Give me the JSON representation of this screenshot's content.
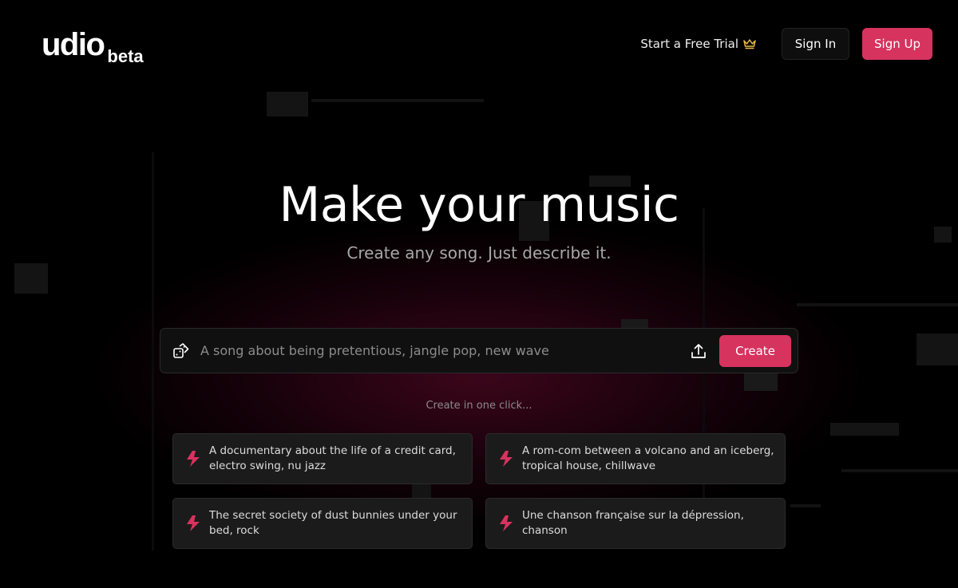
{
  "brand": {
    "name": "udio",
    "badge": "beta",
    "accent_color": "#d6335f",
    "crown_color": "#e8b84a"
  },
  "nav": {
    "trial_label": "Start a Free Trial",
    "trial_icon": "crown-icon",
    "signin_label": "Sign In",
    "signup_label": "Sign Up"
  },
  "hero": {
    "title": "Make your music",
    "subtitle": "Create any song. Just describe it."
  },
  "prompt": {
    "random_icon": "dice-icon",
    "placeholder": "A song about being pretentious, jangle pop, new wave",
    "value": "",
    "upload_icon": "upload-icon",
    "create_label": "Create"
  },
  "suggestions": {
    "heading": "Create in one click...",
    "icon": "lightning-icon",
    "items": [
      {
        "text": "A documentary about the life of a credit card, electro swing, nu jazz"
      },
      {
        "text": "A rom-com between a volcano and an iceberg, tropical house, chillwave"
      },
      {
        "text": "The secret society of dust bunnies under your bed, rock"
      },
      {
        "text": "Une chanson française sur la dépression, chanson"
      }
    ]
  }
}
